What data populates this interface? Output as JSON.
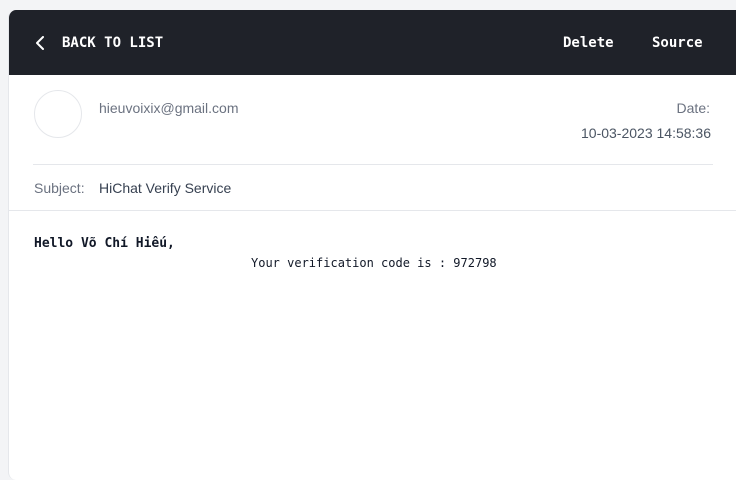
{
  "toolbar": {
    "back_label": "BACK TO LIST",
    "delete_label": "Delete",
    "source_label": "Source"
  },
  "header": {
    "from": "hieuvoixix@gmail.com",
    "date_label": "Date:",
    "date_value": "10-03-2023 14:58:36",
    "subject_label": "Subject:",
    "subject_value": "HiChat Verify Service"
  },
  "body": {
    "greeting": "Hello Võ Chí Hiếu,",
    "code_line": "Your verification code is : 972798"
  },
  "icons": {
    "back": "chevron-left-icon"
  },
  "colors": {
    "toolbar_bg": "#1f2229",
    "toolbar_text": "#ffffff"
  }
}
